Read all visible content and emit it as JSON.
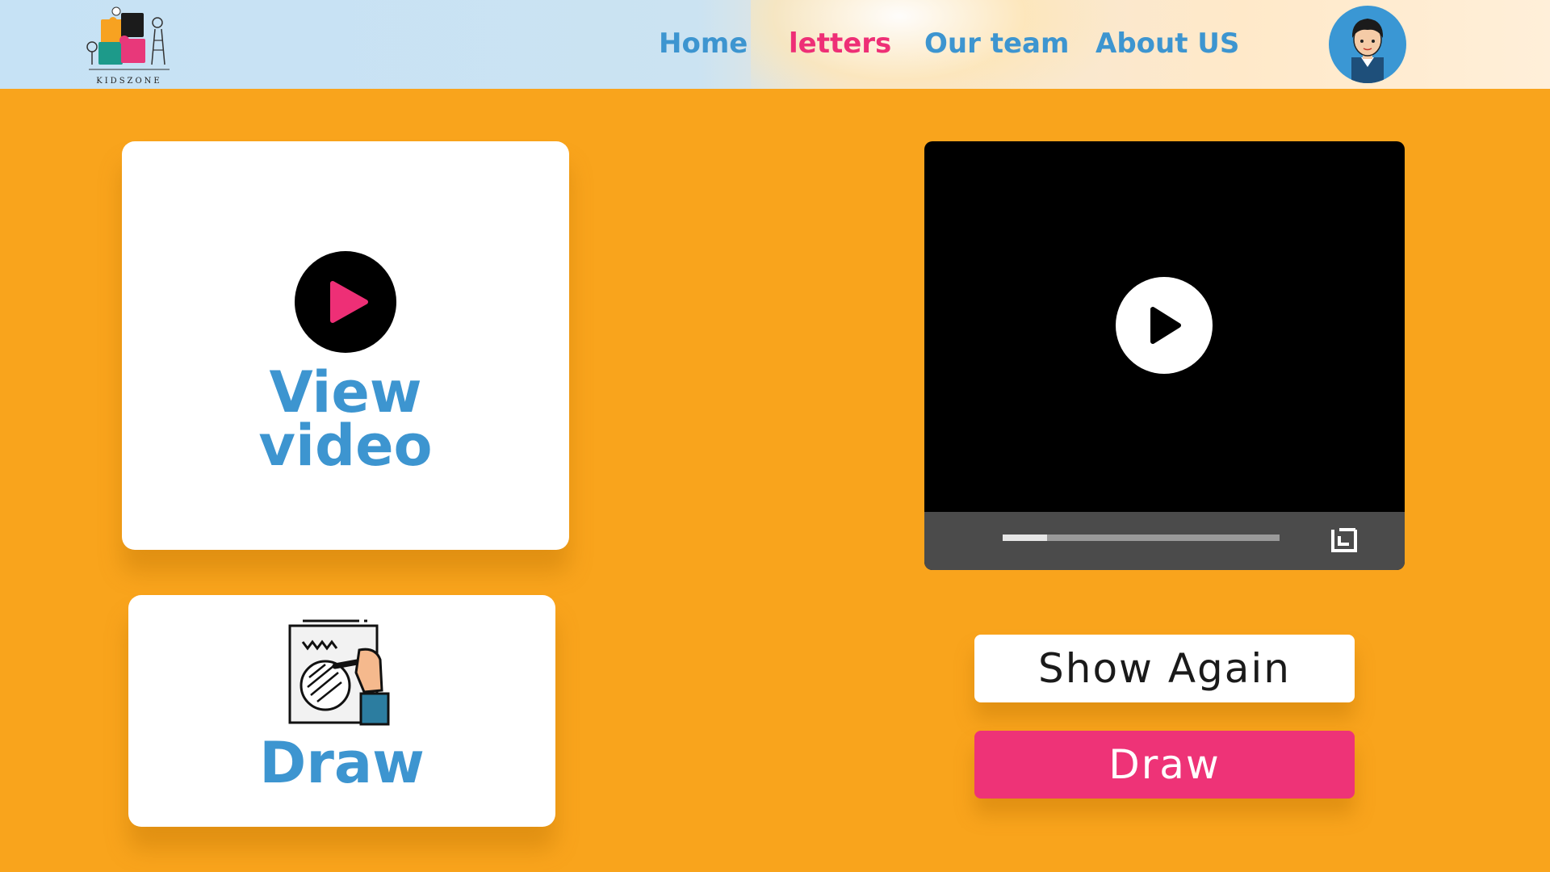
{
  "header": {
    "logo_text": "KIDSZONE",
    "nav": [
      {
        "label": "Home",
        "active": false
      },
      {
        "label": "letters",
        "active": true
      },
      {
        "label": "Our team",
        "active": false
      },
      {
        "label": "About US",
        "active": false
      }
    ]
  },
  "cards": {
    "video": {
      "title_line1": "View",
      "title_line2": "video",
      "icon": "play-icon"
    },
    "draw": {
      "title": "Draw",
      "icon": "drawing-hand-icon"
    }
  },
  "player": {
    "progress_fraction": 0.16,
    "play_icon": "play-icon",
    "fullscreen_icon": "fullscreen-icon"
  },
  "actions": {
    "show_again_label": "Show Again",
    "draw_label": "Draw"
  },
  "colors": {
    "background": "#F9A41C",
    "accent_blue": "#3D95D0",
    "accent_pink": "#EE2F76"
  }
}
